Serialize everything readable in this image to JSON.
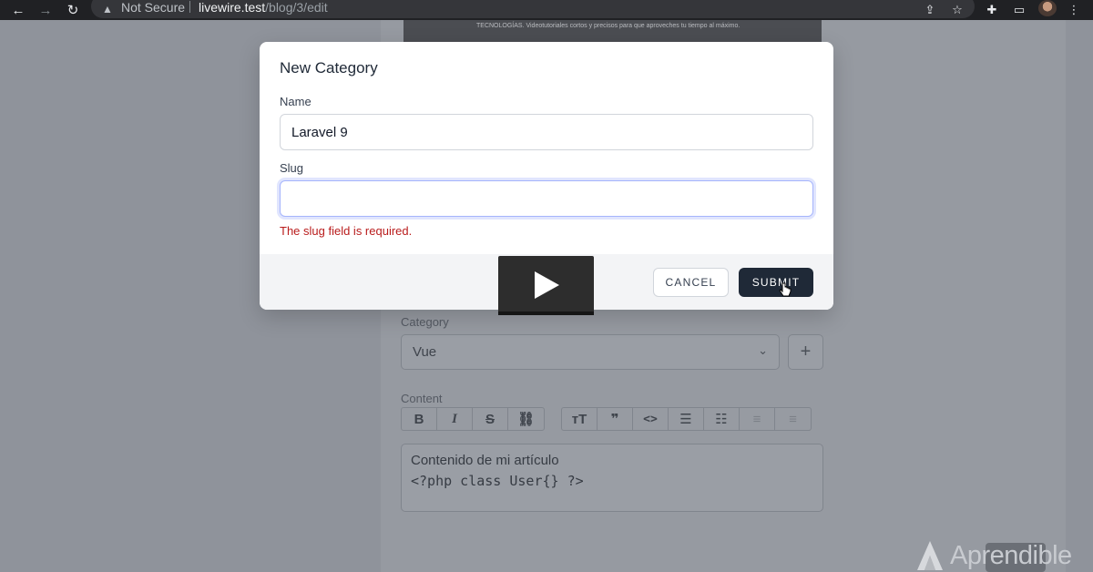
{
  "browser": {
    "security_label": "Not Secure",
    "url_host": "livewire.test",
    "url_path": "/blog/3/edit",
    "icons": [
      "back-arrow-icon",
      "forward-arrow-icon",
      "reload-icon",
      "warning-icon",
      "share-icon",
      "star-icon",
      "extensions-icon",
      "cast-icon",
      "profile-avatar",
      "menu-dots-icon"
    ]
  },
  "page": {
    "banner_text": "TECNOLOGÍAS. Videotutoriales cortos y precisos para que aproveches tu tiempo al máximo.",
    "category_label": "Category",
    "category_value": "Vue",
    "add_category_symbol": "+",
    "content_label": "Content",
    "toolbar_left": [
      {
        "name": "bold-icon",
        "glyph": "B"
      },
      {
        "name": "italic-icon",
        "glyph": "I"
      },
      {
        "name": "strikethrough-icon",
        "glyph": "S"
      },
      {
        "name": "link-icon",
        "glyph": "⛓"
      }
    ],
    "toolbar_right": [
      {
        "name": "heading-icon",
        "glyph": "ᴛT"
      },
      {
        "name": "quote-icon",
        "glyph": "❞"
      },
      {
        "name": "code-icon",
        "glyph": "<>"
      },
      {
        "name": "bullet-list-icon",
        "glyph": "☰"
      },
      {
        "name": "numbered-list-icon",
        "glyph": "☷"
      },
      {
        "name": "decrease-indent-icon",
        "glyph": "≡"
      },
      {
        "name": "increase-indent-icon",
        "glyph": "≡"
      }
    ],
    "editor_line1": "Contenido de mi artículo",
    "editor_line2": "<?php class User{} ?>",
    "brand_name": "Aprendible"
  },
  "modal": {
    "title": "New Category",
    "name_label": "Name",
    "name_value": "Laravel 9",
    "slug_label": "Slug",
    "slug_value": "",
    "slug_error": "The slug field is required.",
    "cancel_label": "CANCEL",
    "submit_label": "SUBMIT"
  },
  "colors": {
    "submit_bg": "#1f2937",
    "error": "#b91c1c",
    "overlay": "#8f939b"
  }
}
